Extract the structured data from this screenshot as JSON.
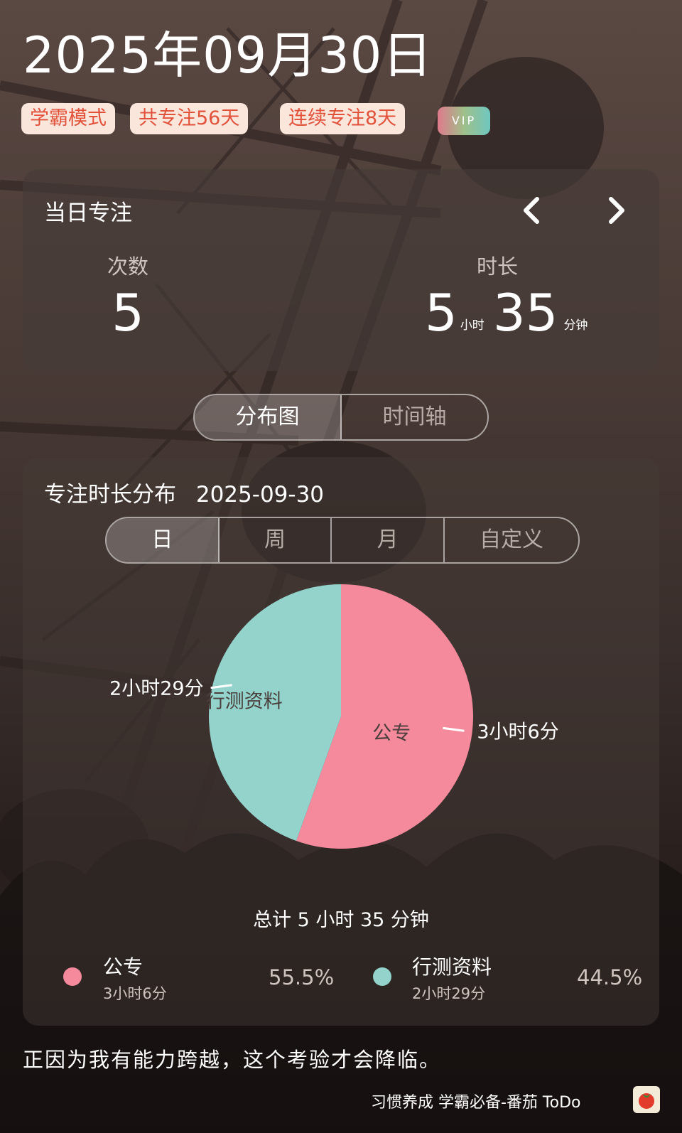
{
  "header": {
    "date": "2025年09月30日",
    "tags": [
      "学霸模式",
      "共专注56天",
      "连续专注8天"
    ],
    "vip_label": "VIP"
  },
  "daily_focus": {
    "title": "当日专注",
    "count_label": "次数",
    "count_value": "5",
    "duration_label": "时长",
    "hours": "5",
    "hours_unit": "小时",
    "minutes": "35",
    "minutes_unit": "分钟"
  },
  "view_tabs": [
    {
      "label": "分布图",
      "active": true
    },
    {
      "label": "时间轴",
      "active": false
    }
  ],
  "distribution": {
    "title": "专注时长分布",
    "date": "2025-09-30",
    "range_tabs": [
      {
        "label": "日",
        "active": true
      },
      {
        "label": "周",
        "active": false
      },
      {
        "label": "月",
        "active": false
      },
      {
        "label": "自定义",
        "active": false
      }
    ],
    "total": "总计 5 小时 35 分钟"
  },
  "chart_data": {
    "type": "pie",
    "slices": [
      {
        "name": "公专",
        "value": 55.5,
        "duration": "3小时6分",
        "percent": "55.5%",
        "color": "#f48a9c"
      },
      {
        "name": "行测资料",
        "value": 44.5,
        "duration": "2小时29分",
        "percent": "44.5%",
        "color": "#93d3cc"
      }
    ]
  },
  "quote": "正因为我有能力跨越，这个考验才会降临。",
  "footer": {
    "slogan": "习惯养成 学霸必备-番茄 ToDo"
  }
}
